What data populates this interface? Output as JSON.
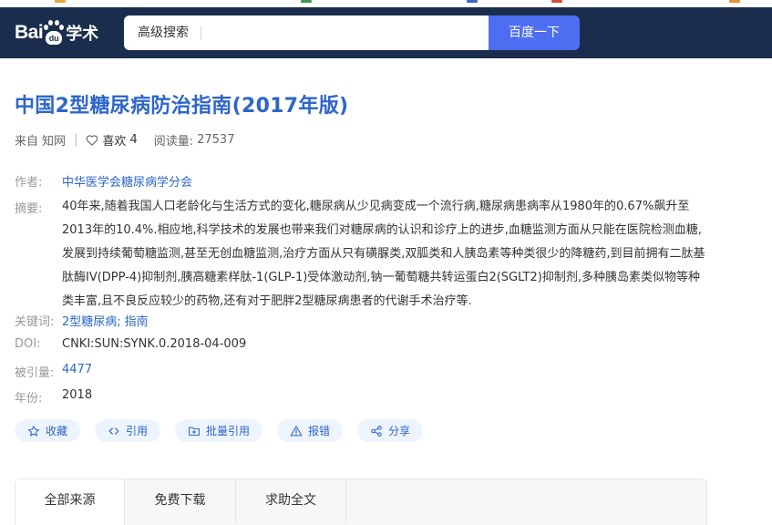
{
  "header": {
    "logo_bai": "Bai",
    "logo_du": "du",
    "logo_xueshu": "学术",
    "advanced_search_label": "高级搜索",
    "search_value": "",
    "search_button_label": "百度一下"
  },
  "paper": {
    "title": "中国2型糖尿病防治指南(2017年版)",
    "source_prefix": "来自",
    "source_name": "知网",
    "likes_label": "喜欢",
    "likes_count": "4",
    "reads_label": "阅读量:",
    "reads_count": "27537",
    "author_label": "作者:",
    "author": "中华医学会糖尿病学分会",
    "abstract_label": "摘要:",
    "abstract": "40年来,随着我国人口老龄化与生活方式的变化,糖尿病从少见病变成一个流行病,糖尿病患病率从1980年的0.67%飙升至2013年的10.4%.相应地,科学技术的发展也带来我们对糖尿病的认识和诊疗上的进步,血糖监测方面从只能在医院检测血糖,发展到持续葡萄糖监测,甚至无创血糖监测,治疗方面从只有磺脲类,双胍类和人胰岛素等种类很少的降糖药,到目前拥有二肽基肽酶IV(DPP-4)抑制剂,胰高糖素样肽-1(GLP-1)受体激动剂,钠一葡萄糖共转运蛋白2(SGLT2)抑制剂,多种胰岛素类似物等种类丰富,且不良反应较少的药物,还有对于肥胖2型糖尿病患者的代谢手术治疗等.",
    "keywords_label": "关键词:",
    "keywords": [
      "2型糖尿病",
      "指南"
    ],
    "keyword_sep": ";",
    "doi_label": "DOI:",
    "doi": "CNKI:SUN:SYNK.0.2018-04-009",
    "cited_label": "被引量:",
    "cited_count": "4477",
    "year_label": "年份:",
    "year": "2018"
  },
  "actions": [
    {
      "label": "收藏",
      "icon": "star-icon"
    },
    {
      "label": "引用",
      "icon": "code-icon"
    },
    {
      "label": "批量引用",
      "icon": "folder-add-icon"
    },
    {
      "label": "报错",
      "icon": "warning-icon"
    },
    {
      "label": "分享",
      "icon": "share-icon"
    }
  ],
  "tabs": [
    {
      "label": "全部来源"
    },
    {
      "label": "免费下载"
    },
    {
      "label": "求助全文"
    }
  ],
  "colors": {
    "header_bg": "#1a2d4c",
    "accent": "#2d66c9",
    "search_button": "#4e6ef2",
    "action_bg": "#eef4fe"
  }
}
